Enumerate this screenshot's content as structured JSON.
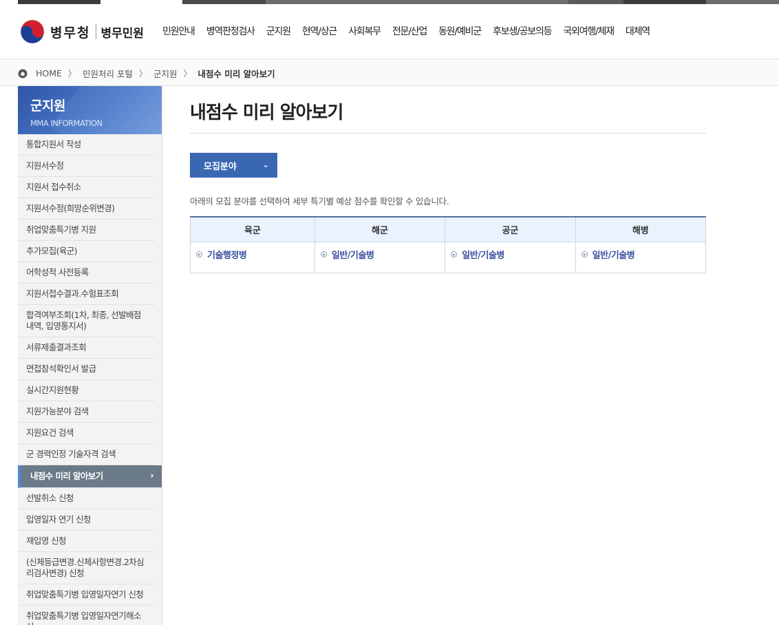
{
  "colors": {
    "accent": "#3a67b2",
    "sidebar_active": "#6a7a89",
    "table_head_bg": "#eaf2fd",
    "link": "#3a50a0"
  },
  "header": {
    "logo_text": "병무청",
    "logo_sub": "병무민원",
    "menu": [
      "민원안내",
      "병역판정검사",
      "군지원",
      "현역/상근",
      "사회복무",
      "전문/산업",
      "동원/예비군",
      "후보생/공보의등",
      "국외여행/체재",
      "대체역"
    ]
  },
  "breadcrumb": {
    "home": "HOME",
    "items": [
      "민원처리 포털",
      "군지원",
      "내점수 미리 알아보기"
    ]
  },
  "sidebar": {
    "title": "군지원",
    "subtitle": "MMA INFORMATION",
    "items": [
      "통합지원서 작성",
      "지원서수정",
      "지원서 접수취소",
      "지원서수정(희망순위변경)",
      "취업맞춤특기병 지원",
      "추가모집(육군)",
      "어학성적 사전등록",
      "지원서접수결과.수험표조회",
      "합격여부조회(1차, 최종, 선발배점내역, 입영통지서)",
      "서류제출결과조회",
      "면접참석확인서 발급",
      "실시간지원현황",
      "지원가능분야 검색",
      "지원요건 검색",
      "군 경력인정 기술자격 검색",
      "내점수 미리 알아보기",
      "선발취소 신청",
      "입영일자 연기 신청",
      "재입영 신청",
      "(신체등급변경.신체사항변경.2차심리검사변경) 신청",
      "취업맞춤특기병 입영일자연기 신청",
      "취업맞춤특기병 입영일자연기해소 신"
    ],
    "active_index": 15
  },
  "main": {
    "title": "내점수 미리 알아보기",
    "dropdown_label": "모집분야",
    "description": "아래의 모집 분야를 선택하여 세부 특기별 예상 점수를 확인할 수 있습니다.",
    "table": {
      "headers": [
        "육군",
        "해군",
        "공군",
        "해병"
      ],
      "links": [
        "기술행정병",
        "일반/기술병",
        "일반/기술병",
        "일반/기술병"
      ]
    }
  }
}
